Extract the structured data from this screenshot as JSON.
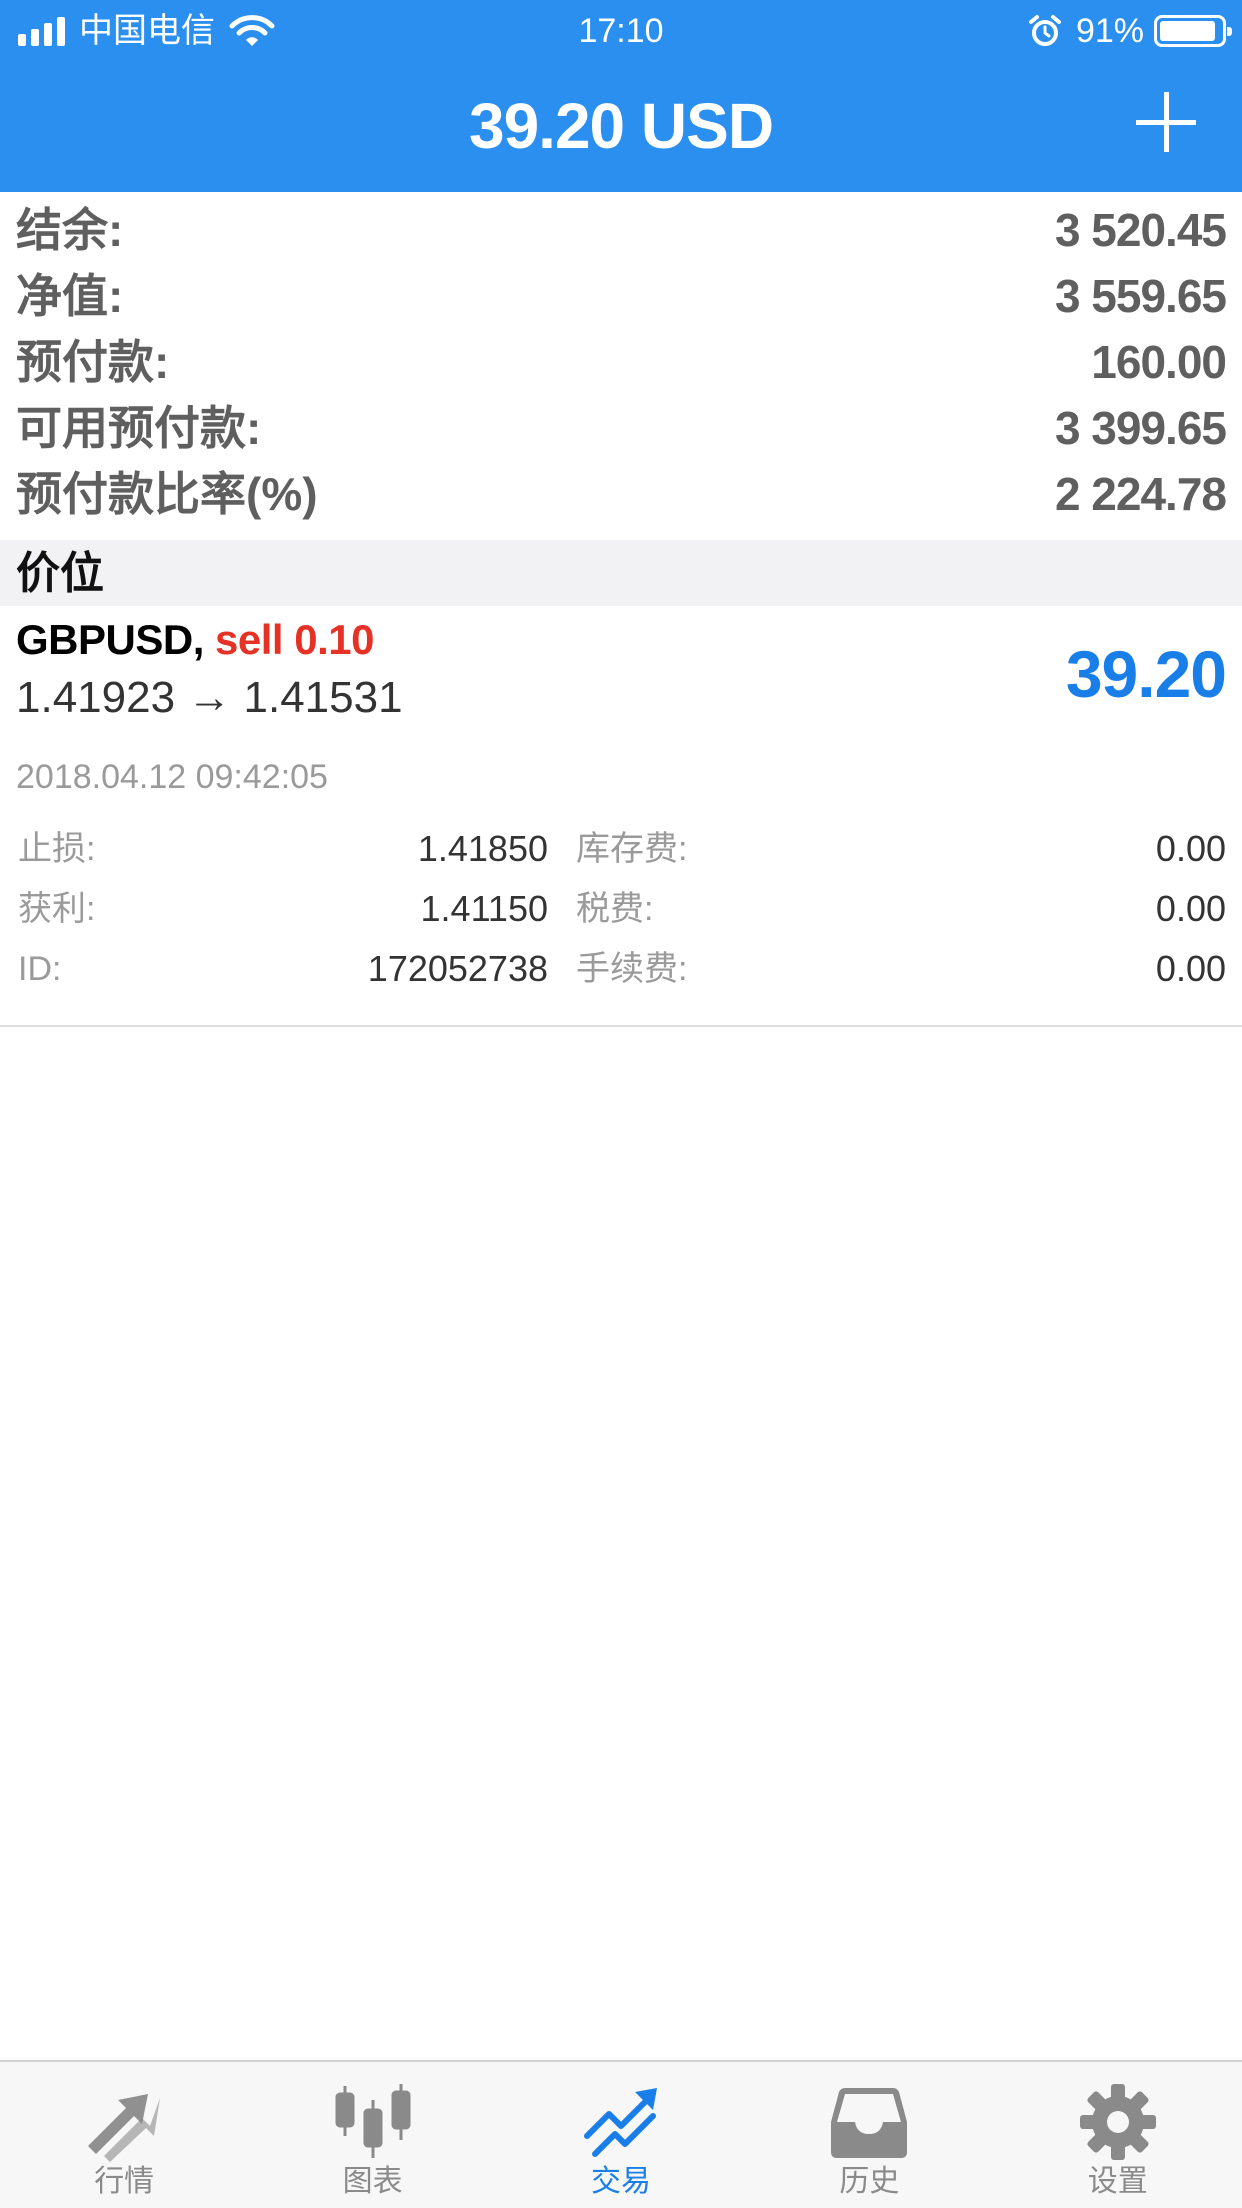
{
  "status_bar": {
    "carrier": "中国电信",
    "time": "17:10",
    "battery_percent": "91%",
    "battery_level": 0.91,
    "icons": [
      "signal-icon",
      "wifi-icon",
      "alarm-icon",
      "battery-icon"
    ]
  },
  "header": {
    "title": "39.20 USD",
    "add_icon": "plus-icon"
  },
  "account": {
    "rows": [
      {
        "label": "结余:",
        "value": "3 520.45"
      },
      {
        "label": "净值:",
        "value": "3 559.65"
      },
      {
        "label": "预付款:",
        "value": "160.00"
      },
      {
        "label": "可用预付款:",
        "value": "3 399.65"
      },
      {
        "label": "预付款比率(%)",
        "value": "2 224.78"
      }
    ]
  },
  "positions": {
    "section_title": "价位",
    "items": [
      {
        "symbol": "GBPUSD,",
        "side": "sell 0.10",
        "prices": "1.41923 → 1.41531",
        "profit": "39.20",
        "open_time": "2018.04.12 09:42:05",
        "details": [
          {
            "label": "止损:",
            "value": "1.41850",
            "label2": "库存费:",
            "value2": "0.00"
          },
          {
            "label": "获利:",
            "value": "1.41150",
            "label2": "税费:",
            "value2": "0.00"
          },
          {
            "label": "ID:",
            "value": "172052738",
            "label2": "手续费:",
            "value2": "0.00"
          }
        ]
      }
    ]
  },
  "colors": {
    "brand_blue": "#2b8ff0",
    "profit_blue": "#1a7ee8",
    "sell_red": "#e53225",
    "inactive_gray": "#8a8a8a"
  },
  "tabbar": {
    "active_index": 2,
    "tabs": [
      {
        "label": "行情",
        "icon": "quotes-arrows-icon"
      },
      {
        "label": "图表",
        "icon": "candlestick-chart-icon"
      },
      {
        "label": "交易",
        "icon": "trade-trend-icon"
      },
      {
        "label": "历史",
        "icon": "history-inbox-icon"
      },
      {
        "label": "设置",
        "icon": "gear-icon"
      }
    ]
  }
}
